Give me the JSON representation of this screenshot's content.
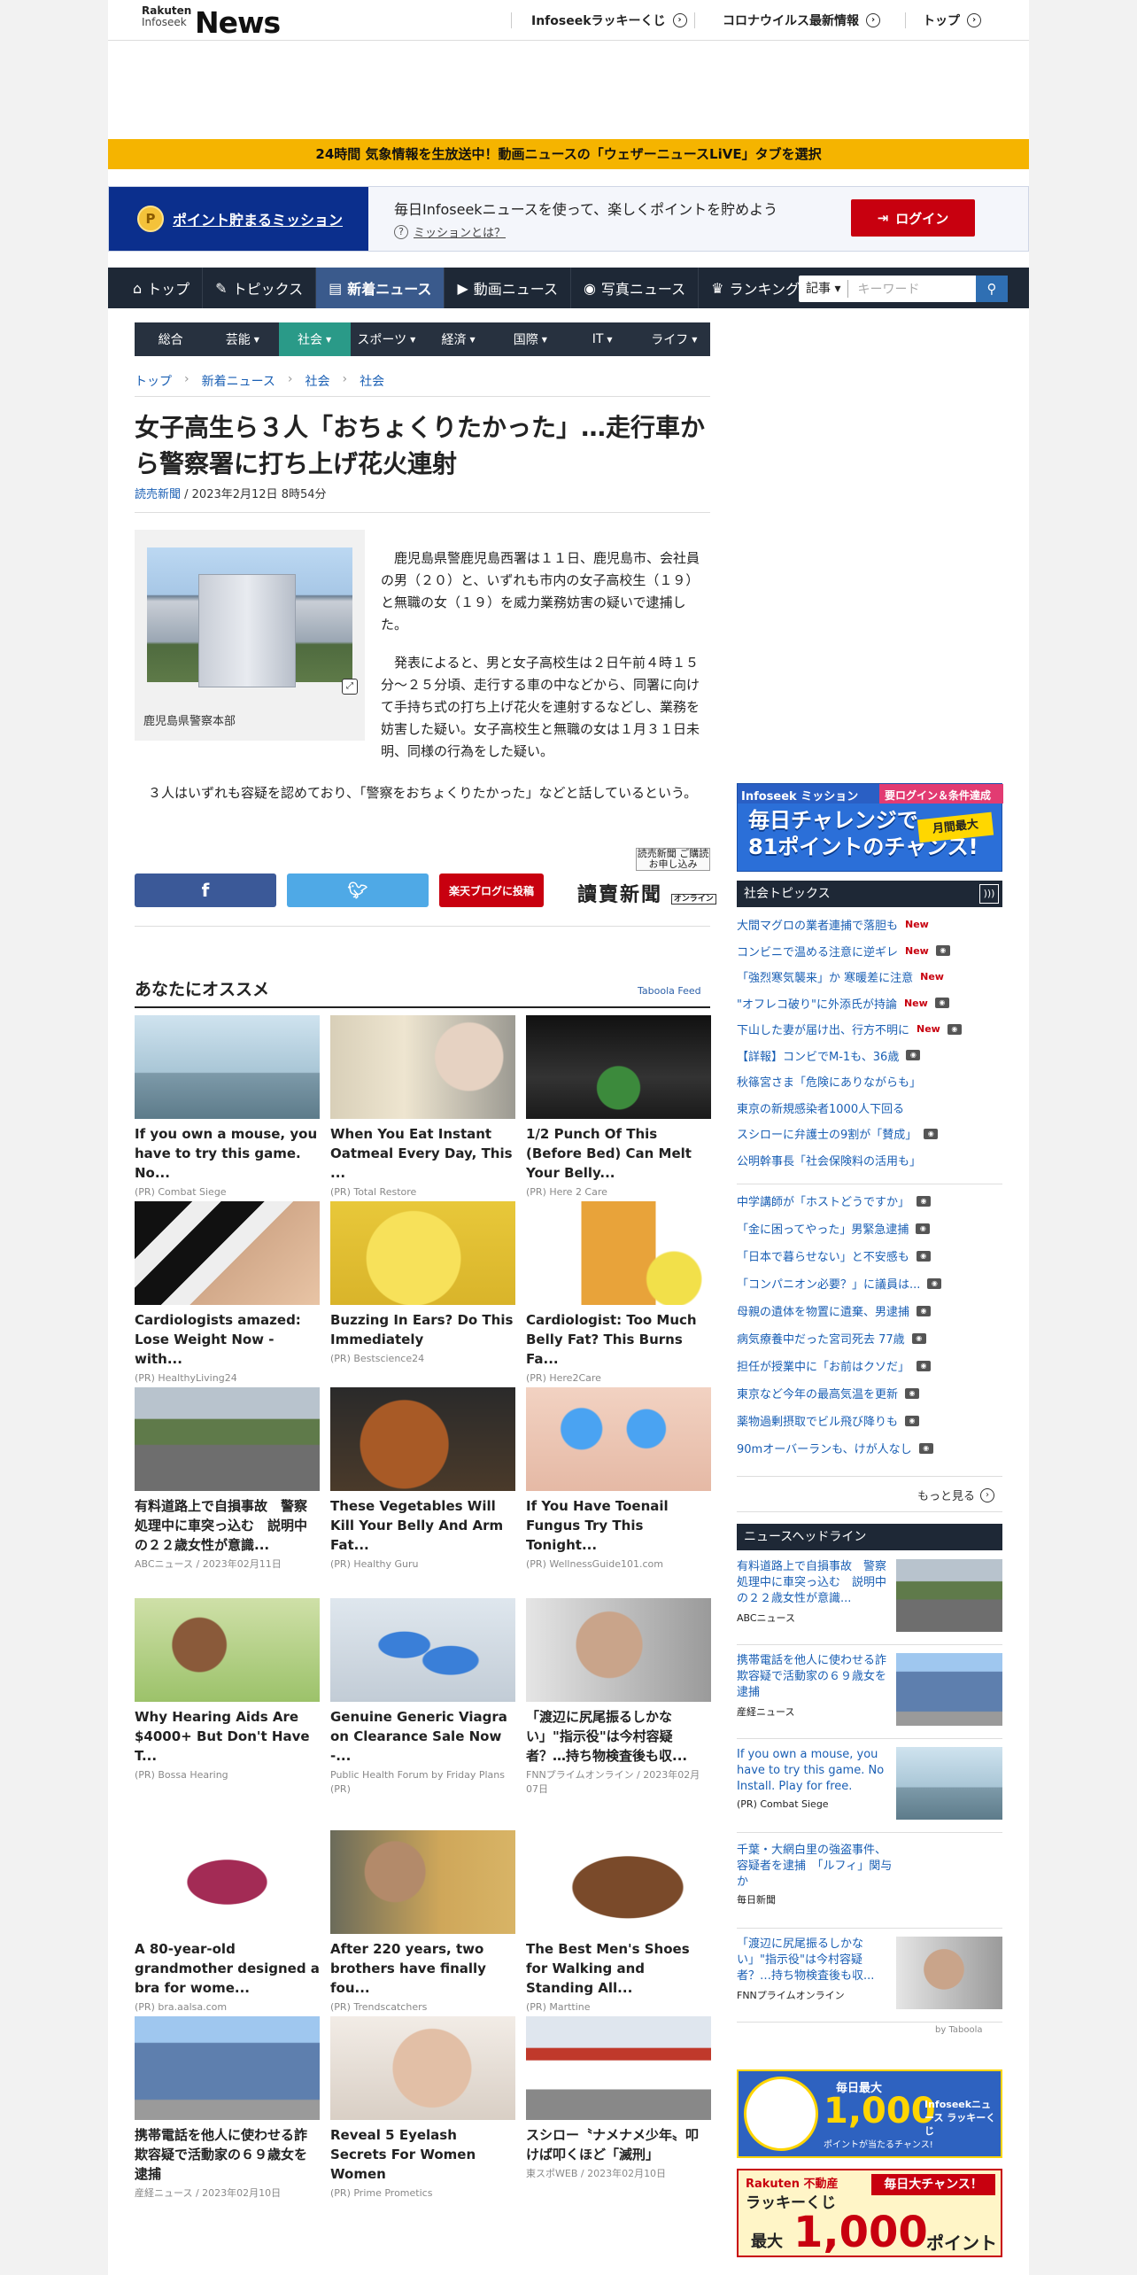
{
  "header": {
    "logo_top": "Rakuten",
    "logo_bottom": "Infoseek",
    "logo_main": "News",
    "links": [
      {
        "label": "Infoseekラッキーくじ"
      },
      {
        "label": "コロナウイルス最新情報"
      },
      {
        "label": "トップ"
      }
    ]
  },
  "weather_banner": "24時間 気象情報を生放送中！動画ニュースの「ウェザーニュースLiVE」タブを選択",
  "mission": {
    "title": "ポイント貯まるミッション",
    "text": "毎日Infoseekニュースを使って、楽しくポイントを貯めよう",
    "link": "ミッションとは？",
    "login": "ログイン"
  },
  "gnav": {
    "items": [
      {
        "label": "トップ",
        "icon": "home-icon"
      },
      {
        "label": "トピックス",
        "icon": "pen-icon"
      },
      {
        "label": "新着ニュース",
        "icon": "doc-icon",
        "active": true
      },
      {
        "label": "動画ニュース",
        "icon": "play-icon"
      },
      {
        "label": "写真ニュース",
        "icon": "camera-icon"
      },
      {
        "label": "ランキング",
        "icon": "crown-icon"
      }
    ],
    "search_select": "記事",
    "search_placeholder": "キーワード"
  },
  "categories": [
    "総合",
    "芸能",
    "社会",
    "スポーツ",
    "経済",
    "国際",
    "IT",
    "ライフ"
  ],
  "breadcrumb": [
    "トップ",
    "新着ニュース",
    "社会",
    "社会"
  ],
  "article": {
    "title": "女子高生ら３人「おちょくりたかった」…走行車から警察署に打ち上げ花火連射",
    "source": "読売新聞",
    "date": " / 2023年2月12日 8時54分",
    "caption": "鹿児島県警察本部",
    "p1": "　鹿児島県警鹿児島西署は１１日、鹿児島市、会社員の男（２０）と、いずれも市内の女子高校生（１９）と無職の女（１９）を威力業務妨害の疑いで逮捕した。",
    "p2": "　発表によると、男と女子高校生は２日午前４時１５分〜２５分頃、走行する車の中などから、同署に向けて手持ち式の打ち上げ花火を連射するなどし、業務を妨害した疑い。女子高校生と無職の女は１月３１日未明、同様の行為をした疑い。",
    "p3": "　３人はいずれも容疑を認めており、「警察をおちょくりたかった」などと話しているという。",
    "yomiuri_mark": "読売新聞 ご購読お申し込み",
    "yomiuri_logo": "讀賣新聞",
    "yomiuri_online": "オンライン",
    "rakuten_blog": "楽天ブログに投稿"
  },
  "recommend": {
    "heading": "あなたにオススメ",
    "taboola": "Taboola Feed",
    "cards": [
      {
        "title": "If you own a mouse, you have to try this game. No...",
        "src": "(PR)  Combat Siege"
      },
      {
        "title": "When You Eat Instant Oatmeal Every Day, This ...",
        "src": "(PR)  Total Restore"
      },
      {
        "title": "1/2 Punch Of This (Before Bed) Can Melt Your Belly...",
        "src": "(PR)  Here 2 Care"
      },
      {
        "title": "Cardiologists amazed: Lose Weight Now - with...",
        "src": "(PR)  HealthyLiving24"
      },
      {
        "title": "Buzzing In Ears? Do This Immediately",
        "src": "(PR)  Bestscience24"
      },
      {
        "title": "Cardiologist: Too Much Belly Fat? This Burns Fa...",
        "src": "(PR)  Here2Care"
      },
      {
        "title": "有料道路上で自損事故　警察処理中に車突っ込む　説明中の２２歳女性が意識...",
        "src": "ABCニュース / 2023年02月11日"
      },
      {
        "title": "These Vegetables Will Kill Your Belly And Arm Fat...",
        "src": "(PR)  Healthy Guru"
      },
      {
        "title": "If You Have Toenail Fungus Try This Tonight...",
        "src": "(PR)  WellnessGuide101.com"
      },
      {
        "title": "Why Hearing Aids Are $4000+ But Don't Have T...",
        "src": "(PR)  Bossa Hearing"
      },
      {
        "title": "Genuine Generic Viagra on Clearance Sale Now -...",
        "src": " Public Health Forum by Friday Plans (PR)"
      },
      {
        "title": "「渡辺に尻尾振るしかない」\"指示役\"は今村容疑者？…持ち物検査後も収...",
        "src": "FNNプライムオンライン / 2023年02月07日"
      },
      {
        "title": "A 80-year-old grandmother designed a bra for wome...",
        "src": "(PR)  bra.aalsa.com"
      },
      {
        "title": "After 220 years, two brothers have finally fou...",
        "src": "(PR)  Trendscatchers"
      },
      {
        "title": "The Best Men's Shoes for Walking and Standing All...",
        "src": "(PR)  Marttine"
      },
      {
        "title": "携帯電話を他人に使わせる詐欺容疑で活動家の６９歳女を逮捕",
        "src": "産経ニュース / 2023年02月10日"
      },
      {
        "title": "Reveal 5 Eyelash Secrets For Women Women",
        "src": "(PR)  Prime Prometics"
      },
      {
        "title": "スシロー〝ナメナメ少年〟叩けば叩くほど「滅刑」",
        "src": "東スポWEB / 2023年02月10日"
      }
    ]
  },
  "sidebar": {
    "mission_banner": {
      "label": "Infoseek ミッション",
      "cond": "要ログイン＆条件達成",
      "big1": "毎日チャレンジで",
      "big2": "81ポイントのチャンス!",
      "tag": "月間最大"
    },
    "topics_title": "社会トピックス",
    "topics": [
      {
        "t": "大間マグロの業者連捕で落胆も",
        "new": true,
        "cam": false
      },
      {
        "t": "コンビニで温める注意に逆ギレ",
        "new": true,
        "cam": true
      },
      {
        "t": "「強烈寒気襲来」か 寒暖差に注意",
        "new": true,
        "cam": false
      },
      {
        "t": "\"オフレコ破り\"に外添氏が持論",
        "new": true,
        "cam": true
      },
      {
        "t": "下山した妻が届け出、行方不明に",
        "new": true,
        "cam": true
      },
      {
        "t": "【詳報】コンビでM-1も、36歳",
        "new": false,
        "cam": true
      },
      {
        "t": "秋篠宮さま「危険にありながらも」",
        "new": false,
        "cam": false
      },
      {
        "t": "東京の新規感染者1000人下回る",
        "new": false,
        "cam": false
      },
      {
        "t": "スシローに弁護士の9割が「賛成」",
        "new": false,
        "cam": true
      },
      {
        "t": "公明幹事長「社会保険料の活用も」",
        "new": false,
        "cam": false
      },
      {
        "t": "中学講師が「ホストどうですか」",
        "new": false,
        "cam": true
      },
      {
        "t": "「金に困ってやった」男緊急逮捕",
        "new": false,
        "cam": true
      },
      {
        "t": "「日本で暮らせない」と不安感も",
        "new": false,
        "cam": true
      },
      {
        "t": "「コンパニオン必要？」に議員は...",
        "new": false,
        "cam": true
      },
      {
        "t": "母親の遺体を物置に遺棄、男逮捕",
        "new": false,
        "cam": true
      },
      {
        "t": "病気療養中だった宮司死去 77歳",
        "new": false,
        "cam": true
      },
      {
        "t": "担任が授業中に「お前はクソだ」",
        "new": false,
        "cam": true
      },
      {
        "t": "東京など今年の最高気温を更新",
        "new": false,
        "cam": true
      },
      {
        "t": "薬物過剰摂取でビル飛び降りも",
        "new": false,
        "cam": true
      },
      {
        "t": "90mオーバーランも、けが人なし",
        "new": false,
        "cam": true
      }
    ],
    "more": "もっと見る",
    "headline_title": "ニュースヘッドライン",
    "headlines": [
      {
        "t": "有料道路上で自損事故　警察処理中に車突っ込む　説明中の２２歳女性が意識...",
        "s": "ABCニュース"
      },
      {
        "t": "携帯電話を他人に使わせる詐欺容疑で活動家の６９歳女を逮捕",
        "s": "産経ニュース"
      },
      {
        "t": "If you own a mouse, you have to try this game. No Install. Play for free.",
        "s": "(PR) Combat Siege"
      },
      {
        "t": "千葉・大網白里の強盗事件、容疑者を逮捕　「ルフィ」関与か",
        "s": "毎日新聞"
      },
      {
        "t": "「渡辺に尻尾振るしかない」\"指示役\"は今村容疑者？…持ち物検査後も収...",
        "s": "FNNプライムオンライン"
      }
    ],
    "by_taboola": "by Taboola",
    "lucky1": {
      "a": "毎日最大",
      "b": "1,000",
      "c": "ポイントが当たるチャンス!",
      "d": "Infoseekニュース ラッキーくじ"
    },
    "lucky2": {
      "a": "Rakuten 不動産",
      "b": "ラッキーくじ",
      "c": "毎日大チャンス！",
      "d": "最大",
      "e": "1,000",
      "f": "ポイント"
    }
  }
}
